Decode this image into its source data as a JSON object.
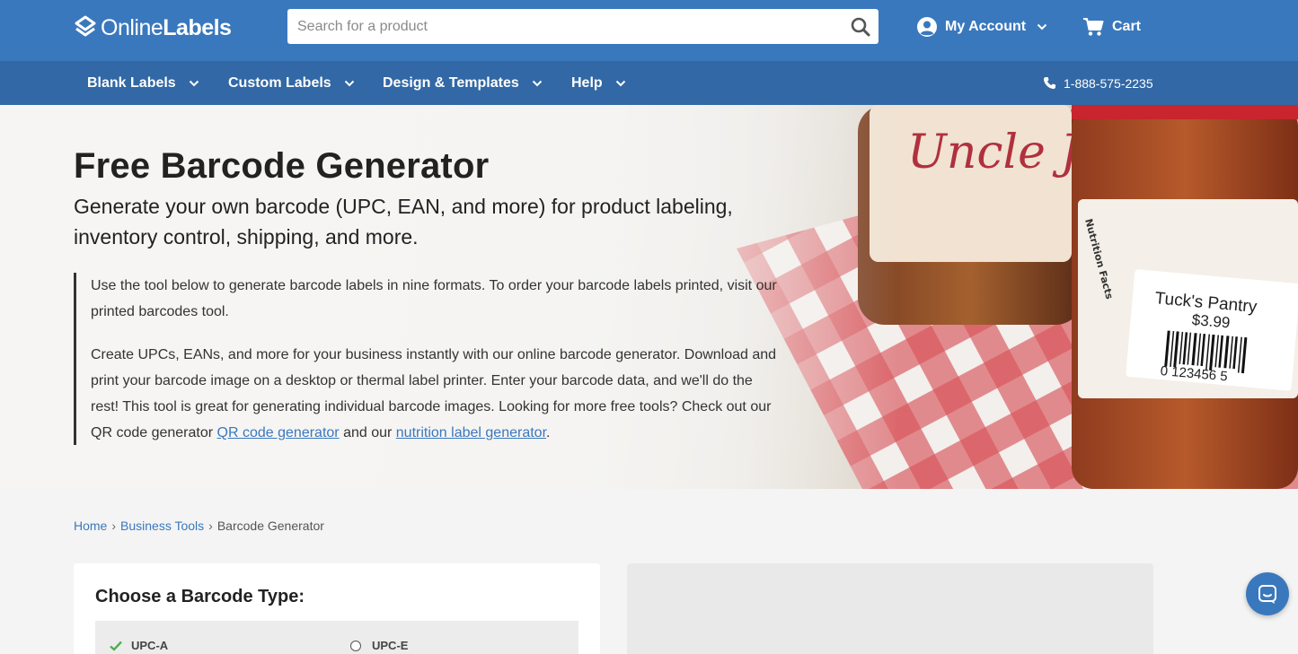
{
  "header": {
    "logo": {
      "part1": "Online",
      "part2": "Labels"
    },
    "search": {
      "placeholder": "Search for a product"
    },
    "account_label": "My Account",
    "cart_label": "Cart"
  },
  "nav": {
    "items": [
      {
        "label": "Blank Labels"
      },
      {
        "label": "Custom Labels"
      },
      {
        "label": "Design & Templates"
      },
      {
        "label": "Help"
      }
    ],
    "phone": "1-888-575-2235"
  },
  "hero": {
    "title": "Free Barcode Generator",
    "subtitle": "Generate your own barcode (UPC, EAN, and more) for product labeling, inventory control, shipping, and more.",
    "para1": "Use the tool below to generate barcode labels in nine formats. To order your barcode labels printed, visit our printed barcodes tool.",
    "para2_text": "Create UPCs, EANs, and more for your business instantly with our online barcode generator. Download and print your barcode image on a desktop or thermal label printer. Enter your barcode data, and we'll do the rest! This tool is great for generating individual barcode images. Looking for more free tools? Check out our QR code generator",
    "link_qr": "QR code generator",
    "and_our": "and our",
    "link_nutrition": "nutrition label generator",
    "period": ".",
    "image_text": {
      "jar1_label": "Uncle Joe's",
      "jar2_label_name": "Tuck's Pantry",
      "jar2_price": "$3.99",
      "jar2_barcode_num": "0 123456 5",
      "jar2_side_text": "Nutrition Facts"
    }
  },
  "breadcrumb": {
    "items": [
      "Home",
      "Business Tools",
      "Barcode Generator"
    ],
    "separator": "›"
  },
  "barcode_panel": {
    "heading": "Choose a Barcode Type:",
    "options": [
      {
        "label": "UPC-A",
        "selected": true
      },
      {
        "label": "UPC-E",
        "selected": false
      }
    ]
  },
  "colors": {
    "header": "#3a78bd",
    "nav": "#3168a5",
    "link": "#3a78bd",
    "check": "#4caf50"
  },
  "icons": [
    "logo-mark-icon",
    "search-icon",
    "user-circle-icon",
    "chevron-down-icon",
    "cart-icon",
    "phone-icon",
    "check-icon",
    "chat-icon"
  ]
}
